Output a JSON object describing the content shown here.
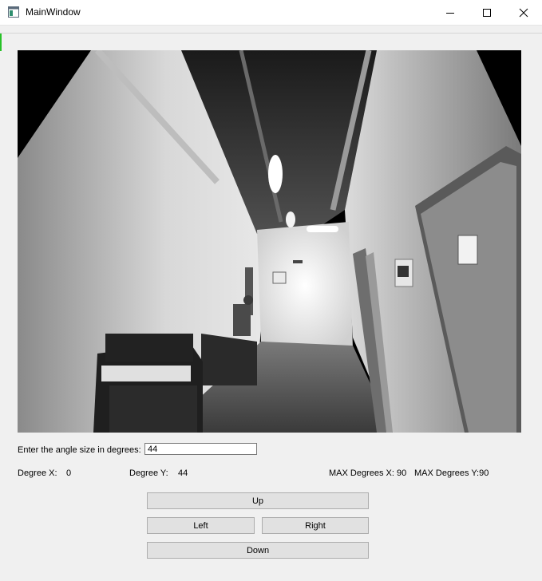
{
  "window": {
    "title": "MainWindow",
    "icon": "app-window-icon"
  },
  "controls": {
    "angle_label": "Enter the angle size in degrees:",
    "angle_value": "44",
    "degree_x_label": "Degree X:",
    "degree_x_value": "0",
    "degree_y_label": "Degree Y:",
    "degree_y_value": "44",
    "max_x_label": "MAX Degrees X: 90",
    "max_y_label": "MAX Degrees Y:90"
  },
  "buttons": {
    "up": "Up",
    "left": "Left",
    "right": "Right",
    "down": "Down"
  },
  "colors": {
    "window_bg": "#f0f0f0",
    "button_bg": "#e1e1e1",
    "button_border": "#adadad",
    "accent": "#27c227"
  }
}
